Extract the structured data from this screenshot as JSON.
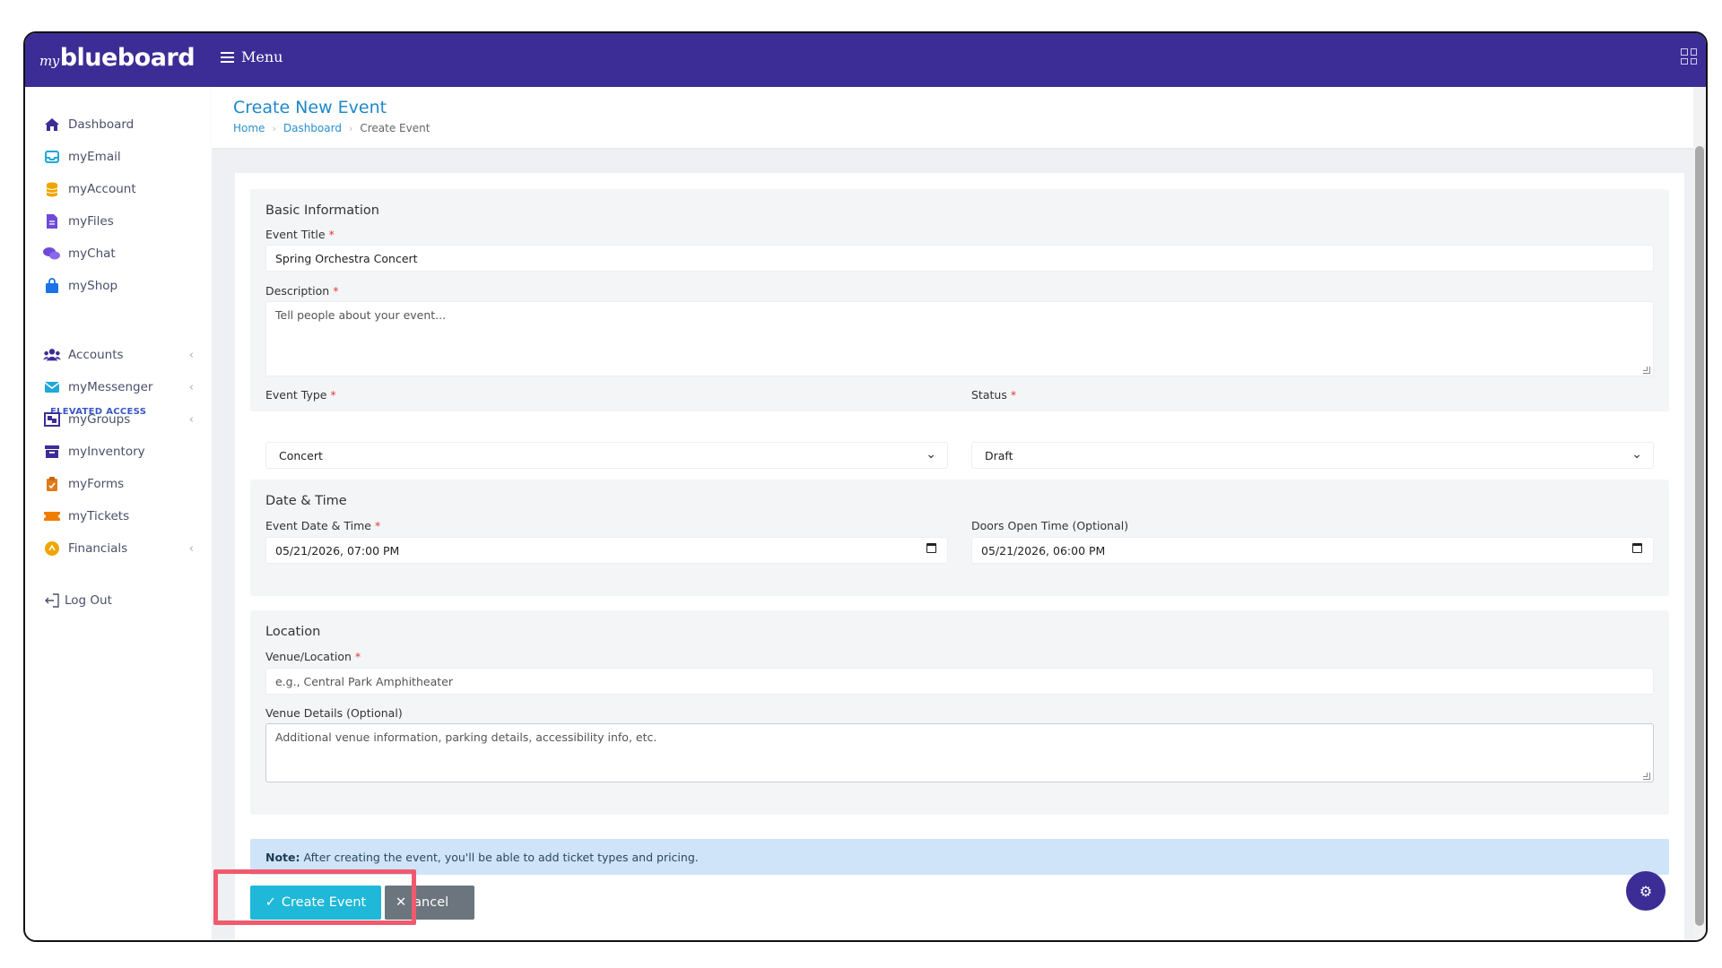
{
  "app": {
    "logo_prefix": "my",
    "logo_main": "blueboard",
    "menu_label": "Menu"
  },
  "sidebar": {
    "items": [
      {
        "label": "Dashboard",
        "icon": "home-icon",
        "color": "#3c2d96"
      },
      {
        "label": "myEmail",
        "icon": "inbox-icon",
        "color": "#1fa8d8"
      },
      {
        "label": "myAccount",
        "icon": "database-icon",
        "color": "#f0a500"
      },
      {
        "label": "myFiles",
        "icon": "file-icon",
        "color": "#6f4ad8"
      },
      {
        "label": "myChat",
        "icon": "chat-icon",
        "color": "#6f4ad8"
      },
      {
        "label": "myShop",
        "icon": "shopping-bag-icon",
        "color": "#1a73e8"
      }
    ],
    "elevated_label": "ELEVATED ACCESS",
    "elevated_items": [
      {
        "label": "Accounts",
        "icon": "users-icon",
        "color": "#3c2d96",
        "has_chevron": true
      },
      {
        "label": "myMessenger",
        "icon": "envelope-icon",
        "color": "#1fa8d8",
        "has_chevron": true
      },
      {
        "label": "myGroups",
        "icon": "groups-icon",
        "color": "#3c2d96",
        "has_chevron": true
      },
      {
        "label": "myInventory",
        "icon": "archive-icon",
        "color": "#3c2d96",
        "has_chevron": false
      },
      {
        "label": "myForms",
        "icon": "clipboard-icon",
        "color": "#e07b1a",
        "has_chevron": false
      },
      {
        "label": "myTickets",
        "icon": "ticket-icon",
        "color": "#f07d00",
        "has_chevron": false
      },
      {
        "label": "Financials",
        "icon": "coins-icon",
        "color": "#f0a500",
        "has_chevron": true
      }
    ],
    "logout_label": "Log Out"
  },
  "header": {
    "title": "Create New Event",
    "breadcrumb": [
      "Home",
      "Dashboard",
      "Create Event"
    ]
  },
  "form": {
    "basic": {
      "title": "Basic Information",
      "event_title_label": "Event Title",
      "event_title_value": "Spring Orchestra Concert",
      "description_label": "Description",
      "description_placeholder": "Tell people about your event...",
      "event_type_label": "Event Type",
      "event_type_value": "Concert",
      "status_label": "Status",
      "status_value": "Draft"
    },
    "datetime": {
      "title": "Date & Time",
      "event_date_label": "Event Date & Time",
      "event_date_value": "05/21/2026, 07:00 PM",
      "doors_label": "Doors Open Time (Optional)",
      "doors_value": "05/21/2026, 06:00 PM"
    },
    "location": {
      "title": "Location",
      "venue_label": "Venue/Location",
      "venue_placeholder": "e.g., Central Park Amphitheater",
      "venue_details_label": "Venue Details (Optional)",
      "venue_details_placeholder": "Additional venue information, parking details, accessibility info, etc."
    },
    "note_bold": "Note:",
    "note_text": "After creating the event, you'll be able to add ticket types and pricing.",
    "create_label": "Create Event",
    "cancel_label": "ancel",
    "required_mark": "*"
  },
  "colors": {
    "topbar": "#3c2d96",
    "accent": "#1fb8d8",
    "link": "#1e88c8",
    "highlight": "#f05a6e"
  }
}
